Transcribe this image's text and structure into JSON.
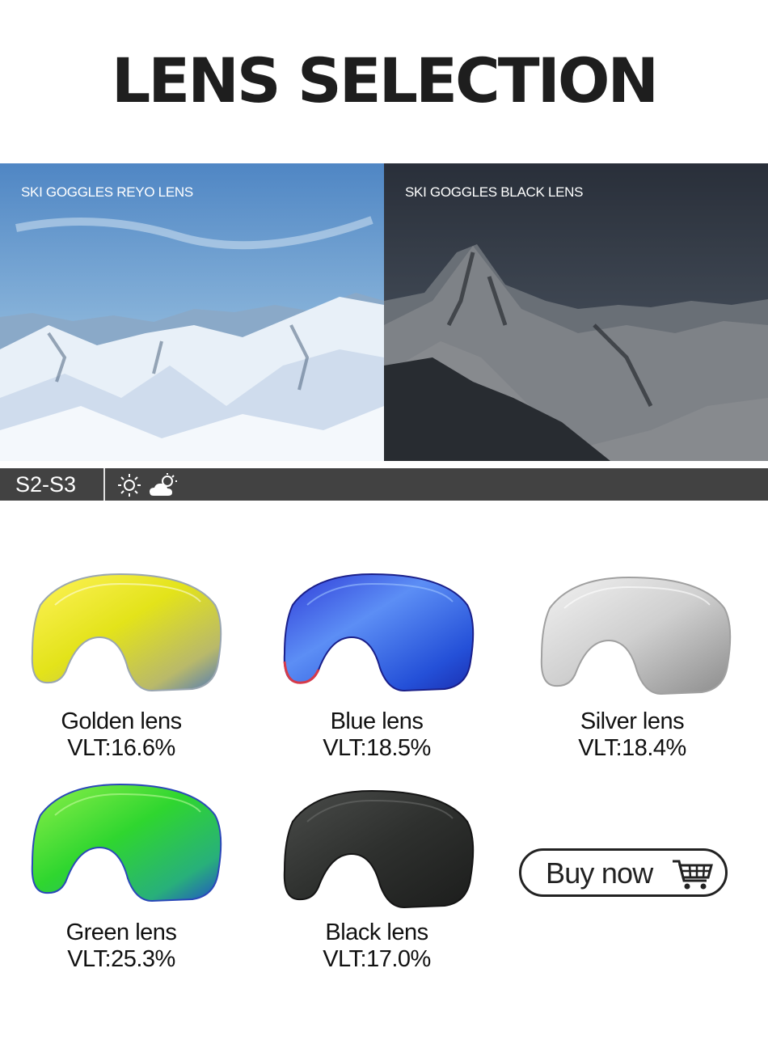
{
  "title": "LENS SELECTION",
  "comparison": {
    "left_label": "SKI GOGGLES REYO LENS",
    "right_label": "SKI GOGGLES BLACK LENS"
  },
  "category_band": {
    "category": "S2-S3",
    "icons": [
      "sun-icon",
      "partly-cloudy-icon"
    ]
  },
  "lenses": [
    {
      "name": "Golden lens",
      "vlt": "VLT:16.6%",
      "color": "#e6e61c"
    },
    {
      "name": "Blue lens",
      "vlt": "VLT:18.5%",
      "color": "#3f6de8"
    },
    {
      "name": "Silver lens",
      "vlt": "VLT:18.4%",
      "color": "#c8c8c8"
    },
    {
      "name": "Green lens",
      "vlt": "VLT:25.3%",
      "color": "#38d43a"
    },
    {
      "name": "Black lens",
      "vlt": "VLT:17.0%",
      "color": "#2e302e"
    }
  ],
  "buy_button": {
    "label": "Buy now",
    "icon": "shopping-cart-icon"
  }
}
